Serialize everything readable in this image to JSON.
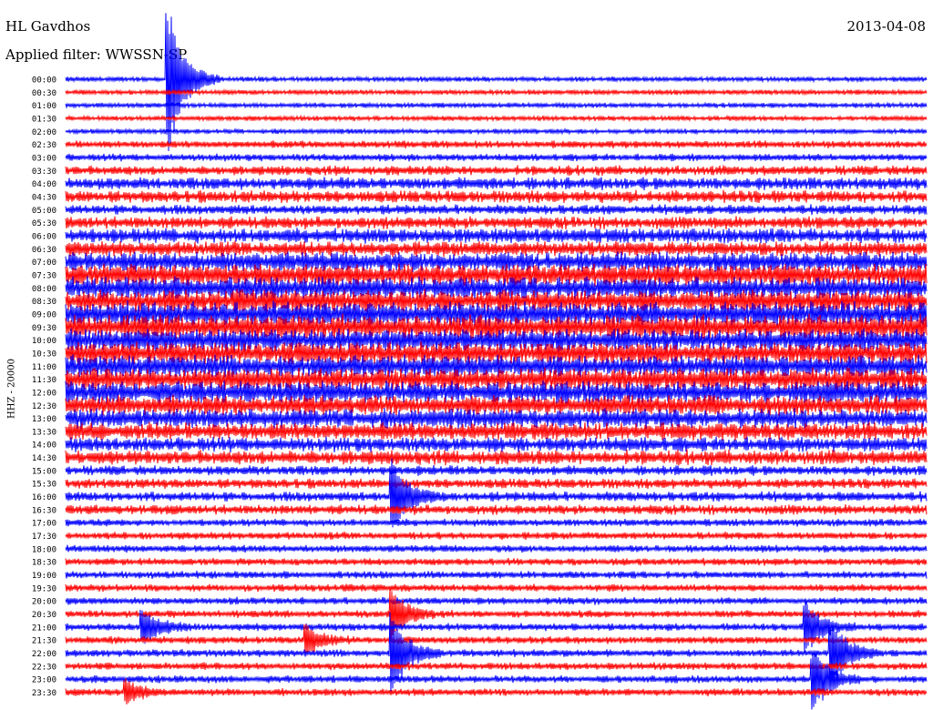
{
  "header": {
    "station": "HL Gavdhos",
    "date": "2013-04-08",
    "filter_label": "Applied filter: WWSSN-SP"
  },
  "chart_data": {
    "type": "line",
    "channel": "HHZ - 20000",
    "row_labels": [
      "00:00",
      "00:30",
      "01:00",
      "01:30",
      "02:00",
      "02:30",
      "03:00",
      "03:30",
      "04:00",
      "04:30",
      "05:00",
      "05:30",
      "06:00",
      "06:30",
      "07:00",
      "07:30",
      "08:00",
      "08:30",
      "09:00",
      "09:30",
      "10:00",
      "10:30",
      "11:00",
      "11:30",
      "12:00",
      "12:30",
      "13:00",
      "13:30",
      "14:00",
      "14:30",
      "15:00",
      "15:30",
      "16:00",
      "16:30",
      "17:00",
      "17:30",
      "18:00",
      "18:30",
      "19:00",
      "19:30",
      "20:00",
      "20:30",
      "21:00",
      "21:30",
      "22:00",
      "22:30",
      "23:00",
      "23:30"
    ],
    "grid": false,
    "legend": "none",
    "colors": {
      "odd": "#0000ff",
      "even": "#ff0000"
    },
    "noise_amplitude": [
      2,
      2,
      2,
      2,
      2,
      3,
      3,
      4,
      5,
      5,
      4,
      5,
      6,
      6,
      8,
      9,
      9,
      9,
      10,
      10,
      9,
      9,
      9,
      9,
      9,
      8,
      8,
      7,
      6,
      6,
      4,
      4,
      4,
      4,
      3,
      3,
      3,
      3,
      3,
      3,
      3,
      3,
      3,
      3,
      3,
      3,
      3,
      3
    ],
    "events": [
      {
        "row": 0,
        "x_fraction": 0.12,
        "amplitude": 80
      },
      {
        "row": 32,
        "x_fraction": 0.38,
        "amplitude": 40
      },
      {
        "row": 41,
        "x_fraction": 0.38,
        "amplitude": 25
      },
      {
        "row": 42,
        "x_fraction": 0.09,
        "amplitude": 18
      },
      {
        "row": 42,
        "x_fraction": 0.86,
        "amplitude": 30
      },
      {
        "row": 43,
        "x_fraction": 0.28,
        "amplitude": 16
      },
      {
        "row": 44,
        "x_fraction": 0.38,
        "amplitude": 45
      },
      {
        "row": 44,
        "x_fraction": 0.89,
        "amplitude": 40
      },
      {
        "row": 46,
        "x_fraction": 0.87,
        "amplitude": 35
      },
      {
        "row": 47,
        "x_fraction": 0.07,
        "amplitude": 12
      }
    ]
  }
}
